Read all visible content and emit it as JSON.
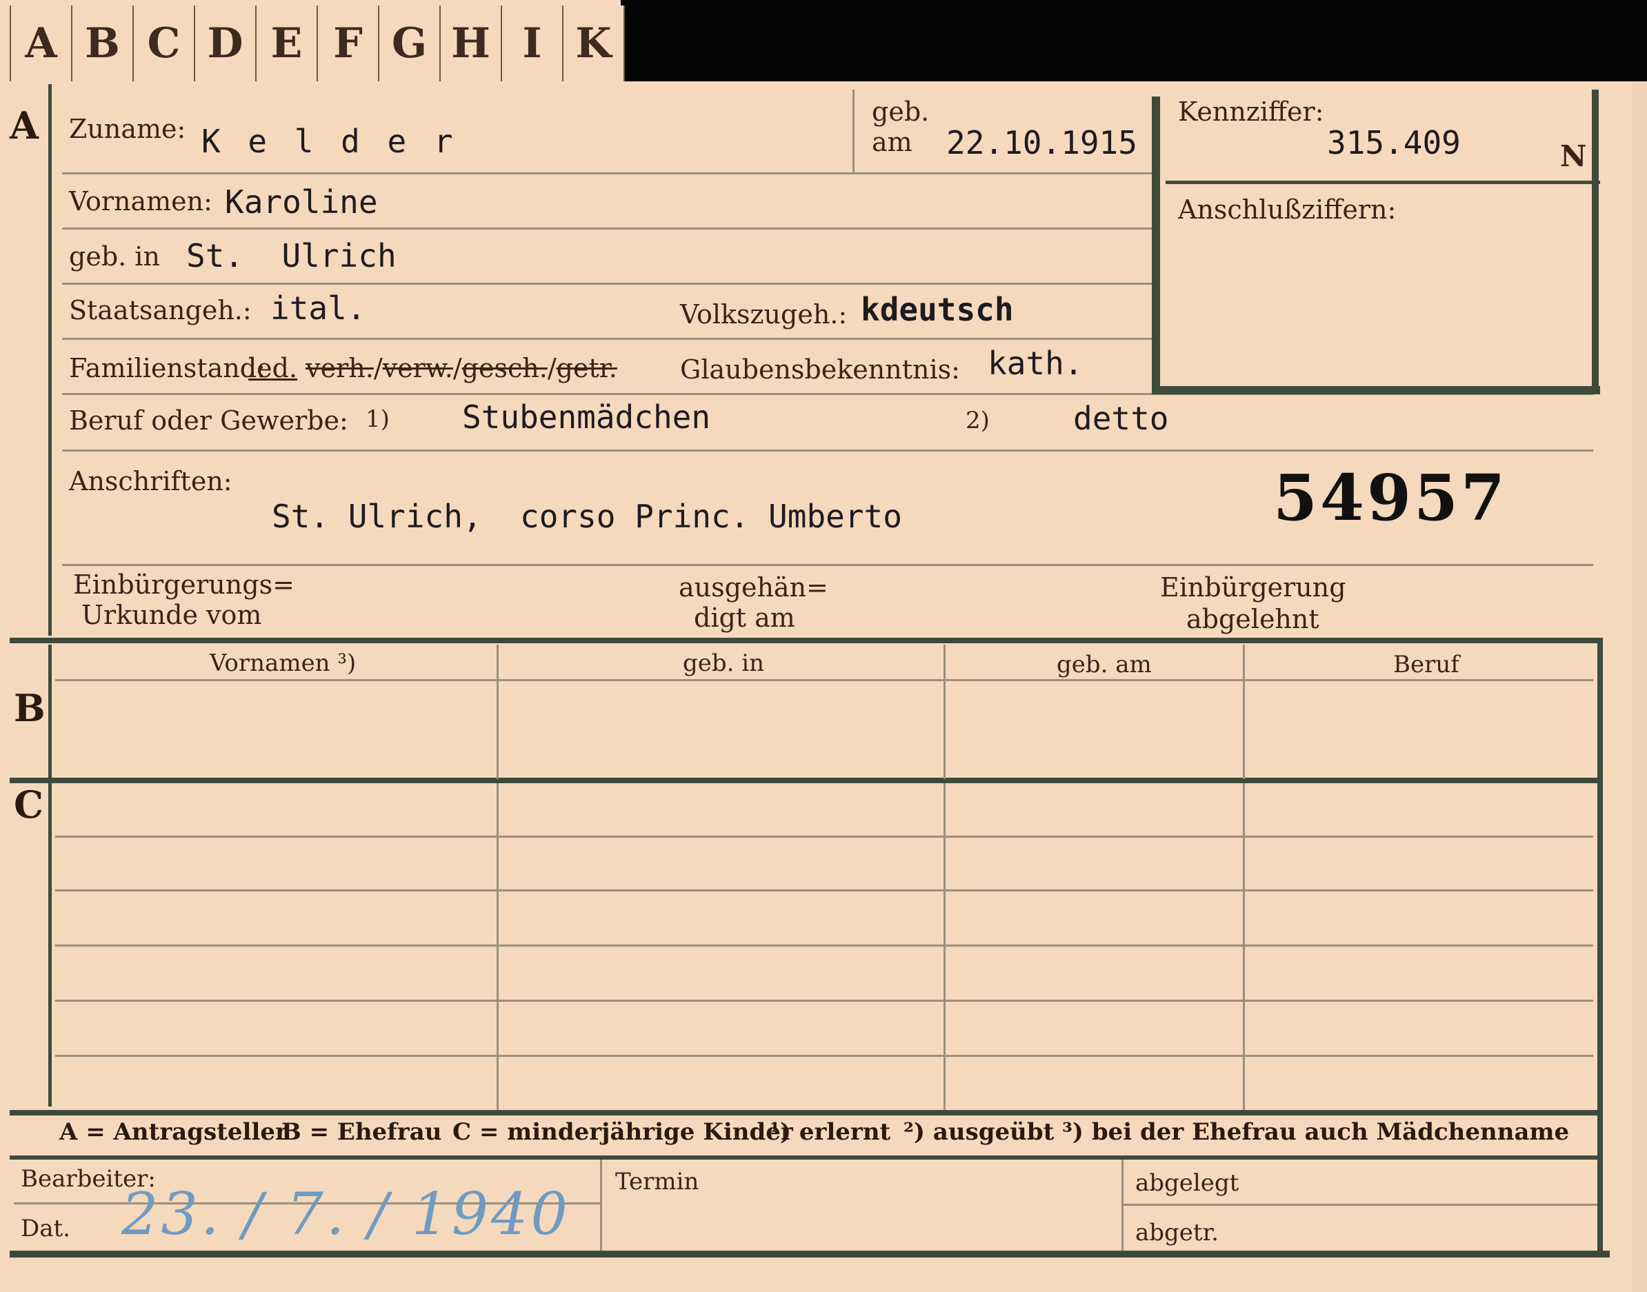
{
  "tabs": [
    "A",
    "B",
    "C",
    "D",
    "E",
    "F",
    "G",
    "H",
    "I",
    "K"
  ],
  "section_a": {
    "letter": "A",
    "zuname_label": "Zuname:",
    "zuname_value": "K e l d e r",
    "geb_am_label_1": "geb.",
    "geb_am_label_2": "am",
    "geb_am_value": "22.10.1915",
    "kennziffer_label": "Kennziffer:",
    "kennziffer_value": "315.409",
    "kennziffer_suffix": "N",
    "anschluss_label": "Anschlußziffern:",
    "vornamen_label": "Vornamen:",
    "vornamen_value": "Karoline",
    "geb_in_label": "geb. in",
    "geb_in_value": "St.  Ulrich",
    "staatsangeh_label": "Staatsangeh.:",
    "staatsangeh_value": "ital.",
    "volkszugeh_label": "Volkszugeh.:",
    "volkszugeh_value": "kdeutsch",
    "familienstand_label": "Familienstand:",
    "familienstand_options": [
      "led.",
      "verh.",
      "verw.",
      "gesch.",
      "getr."
    ],
    "glaubens_label": "Glaubensbekenntnis:",
    "glaubens_value": "kath.",
    "beruf_label": "Beruf oder Gewerbe:",
    "beruf_mark_1": "1)",
    "beruf_value_1": "Stubenmädchen",
    "beruf_mark_2": "2)",
    "beruf_value_2": "detto",
    "anschriften_label": "Anschriften:",
    "anschriften_value": "St. Ulrich,  corso Princ. Umberto",
    "stamp_number": "54957",
    "einb_urkunde_label_1": "Einbürgerungs=",
    "einb_urkunde_label_2": "Urkunde vom",
    "ausgeh_label_1": "ausgehän=",
    "ausgeh_label_2": "digt am",
    "einb_abgelehnt_label_1": "Einbürgerung",
    "einb_abgelehnt_label_2": "abgelehnt"
  },
  "section_b": {
    "letter": "B",
    "columns": [
      "Vornamen ³)",
      "geb. in",
      "geb. am",
      "Beruf"
    ]
  },
  "section_c": {
    "letter": "C"
  },
  "legend": {
    "a": "A = Antragsteller",
    "b": "B = Ehefrau",
    "c": "C = minderjährige Kinder",
    "n1": "¹) erlernt",
    "n2": "²) ausgeübt",
    "n3": "³) bei der Ehefrau auch Mädchenname"
  },
  "footer": {
    "bearbeiter_label": "Bearbeiter:",
    "dat_label": "Dat.",
    "dat_value": "23. / 7. / 1940",
    "termin_label": "Termin",
    "abgelegt_label": "abgelegt",
    "abgetr_label": "abgetr."
  }
}
